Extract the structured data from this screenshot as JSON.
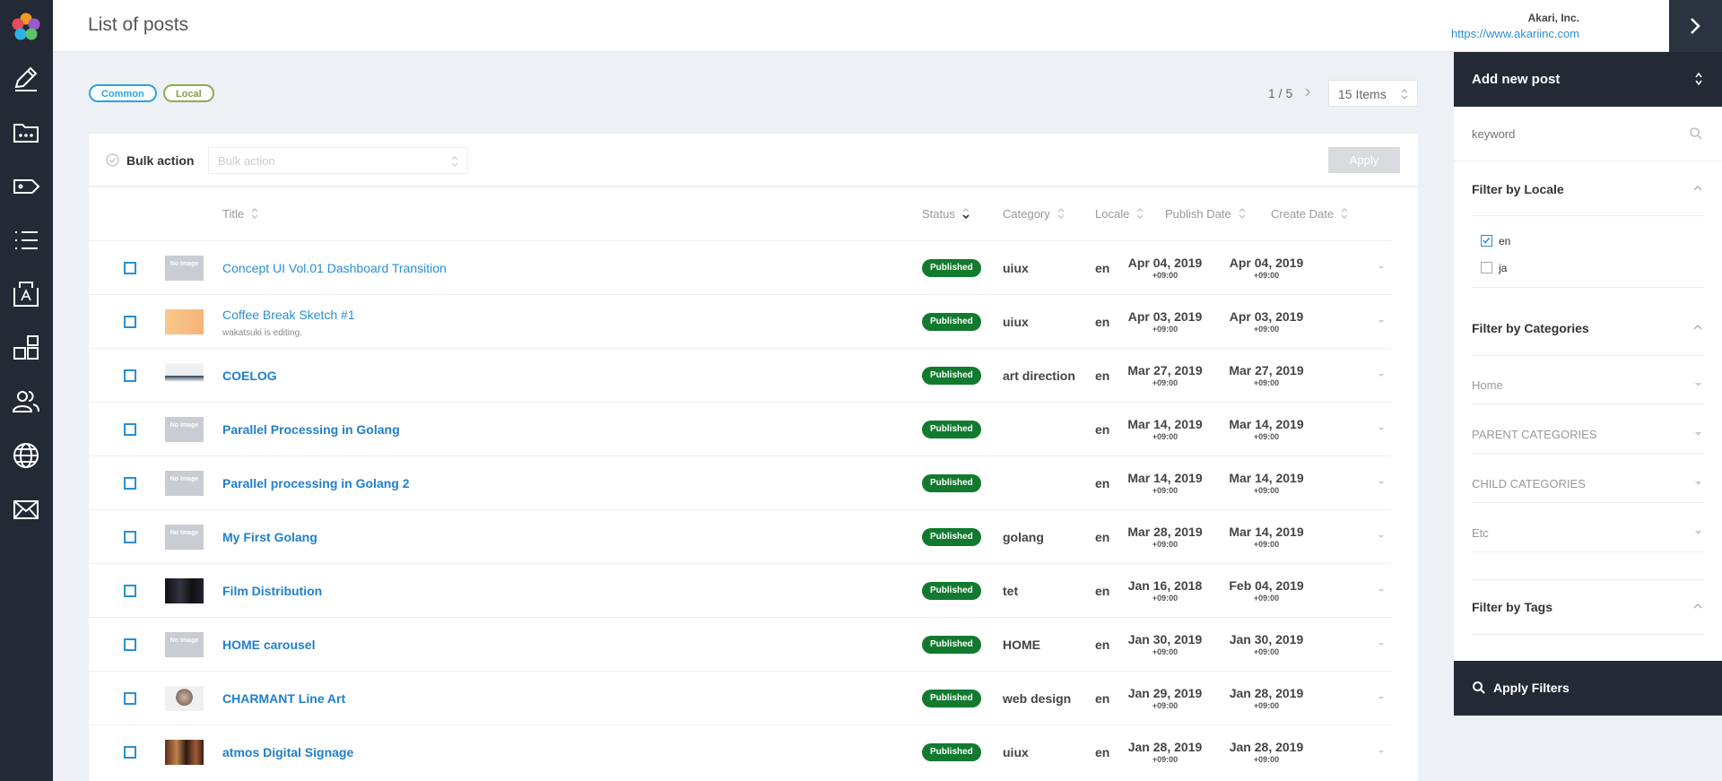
{
  "header": {
    "title": "List of posts",
    "company": "Akari, Inc.",
    "company_url": "https://www.akariinc.com"
  },
  "sidebar": {
    "icons": [
      "pencil-icon",
      "folder-icon",
      "tag-icon",
      "list-icon",
      "image-text-icon",
      "blocks-icon",
      "users-icon",
      "globe-icon",
      "mail-icon"
    ]
  },
  "chips": {
    "common": "Common",
    "local": "Local"
  },
  "pagination": {
    "page": "1 / 5",
    "items": "15 Items"
  },
  "bulk": {
    "label": "Bulk action",
    "placeholder": "Bulk action",
    "apply": "Apply"
  },
  "columns": {
    "title": "Title",
    "status": "Status",
    "category": "Category",
    "locale": "Locale",
    "publish_date": "Publish Date",
    "create_date": "Create Date"
  },
  "posts": [
    {
      "thumb": "none",
      "title": "Concept UI Vol.01 Dashboard Transition",
      "bold": false,
      "subtitle": "",
      "status": "Published",
      "category": "uiux",
      "locale": "en",
      "publish_date": "Apr 04, 2019",
      "publish_tz": "+09:00",
      "create_date": "Apr 04, 2019",
      "create_tz": "+09:00"
    },
    {
      "thumb": "sketch",
      "title": "Coffee Break Sketch #1",
      "bold": false,
      "subtitle": "wakatsuki is editing.",
      "status": "Published",
      "category": "uiux",
      "locale": "en",
      "publish_date": "Apr 03, 2019",
      "publish_tz": "+09:00",
      "create_date": "Apr 03, 2019",
      "create_tz": "+09:00"
    },
    {
      "thumb": "coelog",
      "title": "COELOG",
      "bold": true,
      "subtitle": "",
      "status": "Published",
      "category": "art direction",
      "locale": "en",
      "publish_date": "Mar 27, 2019",
      "publish_tz": "+09:00",
      "create_date": "Mar 27, 2019",
      "create_tz": "+09:00"
    },
    {
      "thumb": "none",
      "title": "Parallel Processing in Golang",
      "bold": true,
      "subtitle": "",
      "status": "Published",
      "category": "",
      "locale": "en",
      "publish_date": "Mar 14, 2019",
      "publish_tz": "+09:00",
      "create_date": "Mar 14, 2019",
      "create_tz": "+09:00"
    },
    {
      "thumb": "none",
      "title": "Parallel processing in Golang 2",
      "bold": true,
      "subtitle": "",
      "status": "Published",
      "category": "",
      "locale": "en",
      "publish_date": "Mar 14, 2019",
      "publish_tz": "+09:00",
      "create_date": "Mar 14, 2019",
      "create_tz": "+09:00"
    },
    {
      "thumb": "none",
      "title": "My First Golang",
      "bold": true,
      "subtitle": "",
      "status": "Published",
      "category": "golang",
      "locale": "en",
      "publish_date": "Mar 28, 2019",
      "publish_tz": "+09:00",
      "create_date": "Mar 14, 2019",
      "create_tz": "+09:00"
    },
    {
      "thumb": "film",
      "title": "Film Distribution",
      "bold": true,
      "subtitle": "",
      "status": "Published",
      "category": "tet",
      "locale": "en",
      "publish_date": "Jan 16, 2018",
      "publish_tz": "+09:00",
      "create_date": "Feb 04, 2019",
      "create_tz": "+09:00"
    },
    {
      "thumb": "none",
      "title": "HOME carousel",
      "bold": true,
      "subtitle": "",
      "status": "Published",
      "category": "HOME",
      "locale": "en",
      "publish_date": "Jan 30, 2019",
      "publish_tz": "+09:00",
      "create_date": "Jan 30, 2019",
      "create_tz": "+09:00"
    },
    {
      "thumb": "portrait",
      "title": "CHARMANT Line Art",
      "bold": true,
      "subtitle": "",
      "status": "Published",
      "category": "web design",
      "locale": "en",
      "publish_date": "Jan 29, 2019",
      "publish_tz": "+09:00",
      "create_date": "Jan 28, 2019",
      "create_tz": "+09:00"
    },
    {
      "thumb": "signage",
      "title": "atmos Digital Signage",
      "bold": true,
      "subtitle": "",
      "status": "Published",
      "category": "uiux",
      "locale": "en",
      "publish_date": "Jan 28, 2019",
      "publish_tz": "+09:00",
      "create_date": "Jan 28, 2019",
      "create_tz": "+09:00"
    }
  ],
  "no_image": "No Image",
  "panel": {
    "title": "Add new post",
    "keyword_placeholder": "keyword",
    "locale_title": "Filter by Locale",
    "locale_options": [
      {
        "label": "en",
        "checked": true
      },
      {
        "label": "ja",
        "checked": false
      }
    ],
    "categories_title": "Filter by Categories",
    "categories": [
      "Home",
      "PARENT CATEGORIES",
      "CHILD CATEGORIES",
      "Etc"
    ],
    "tags_title": "Filter by Tags",
    "apply_filters": "Apply Filters"
  },
  "colors": {
    "sidebar": "#232a36",
    "accent": "#2a8fd4",
    "published": "#127a2e",
    "common_chip": "#2aa4e0",
    "local_chip": "#8aae4a"
  }
}
